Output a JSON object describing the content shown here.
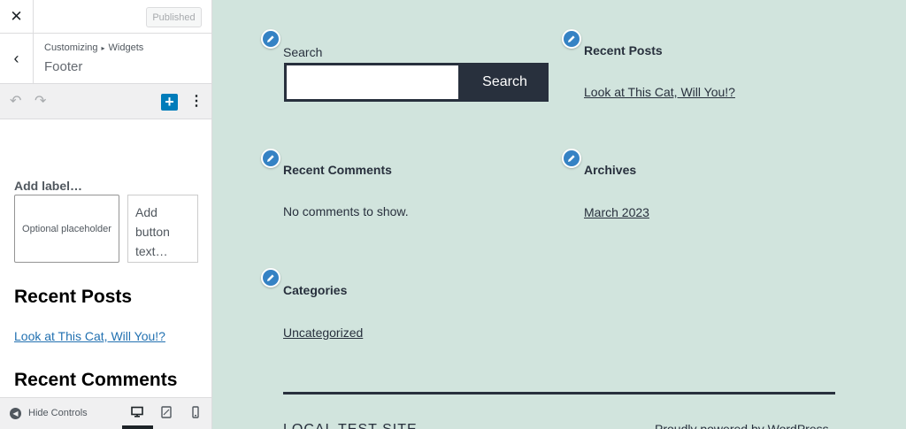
{
  "sidebar": {
    "close_glyph": "✕",
    "publish_label": "Published",
    "back_glyph": "‹",
    "breadcrumb": {
      "parent": "Customizing",
      "arrow": "▸",
      "child": "Widgets"
    },
    "title": "Footer",
    "toolbar": {
      "undo_glyph": "↶",
      "redo_glyph": "↷",
      "add_glyph": "+",
      "more_glyph": "⋮"
    },
    "search_block": {
      "label_placeholder": "Add label…",
      "input_placeholder": "Optional placeholder",
      "button_placeholder": "Add button text…"
    },
    "recent_posts_heading": "Recent Posts",
    "recent_posts_link": "Look at This Cat, Will You!?",
    "recent_comments_heading": "Recent Comments",
    "footer": {
      "hide_glyph": "◀",
      "hide_label": "Hide Controls"
    }
  },
  "preview": {
    "search": {
      "label": "Search",
      "button": "Search"
    },
    "recent_posts": {
      "title": "Recent Posts",
      "link": "Look at This Cat, Will You!?"
    },
    "recent_comments": {
      "title": "Recent Comments",
      "text": "No comments to show."
    },
    "archives": {
      "title": "Archives",
      "link": "March 2023"
    },
    "categories": {
      "title": "Categories",
      "link": "Uncategorized"
    },
    "footer": {
      "site_name": "LOCAL TEST SITE",
      "powered_by": "Proudly powered by WordPress"
    }
  },
  "colors": {
    "accent": "#007cba",
    "preview_bg": "#d1e4dd",
    "text_dark": "#28303d",
    "edit_dot": "#3582c4"
  },
  "icons": [
    "close-icon",
    "back-icon",
    "undo-icon",
    "redo-icon",
    "plus-icon",
    "more-icon",
    "pencil-icon",
    "desktop-icon",
    "tablet-icon",
    "mobile-icon",
    "hide-icon"
  ]
}
